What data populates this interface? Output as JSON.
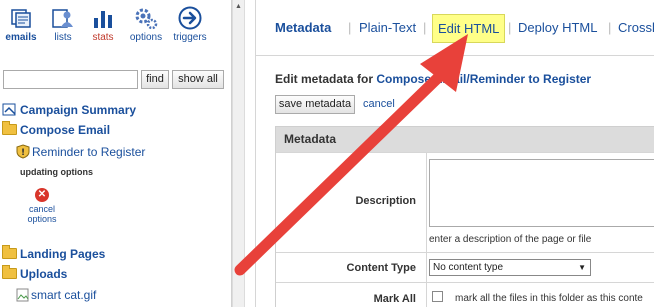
{
  "toolbar": {
    "emails": "emails",
    "lists": "lists",
    "stats": "stats",
    "options": "options",
    "triggers": "triggers"
  },
  "search": {
    "value": "",
    "placeholder": ""
  },
  "buttons": {
    "find": "find",
    "show_all": "show all"
  },
  "tree": {
    "campaign_summary": "Campaign Summary",
    "compose_email": "Compose Email",
    "reminder": "Reminder to Register",
    "updating": "updating options",
    "cancel_options": "cancel options",
    "landing_pages": "Landing Pages",
    "uploads": "Uploads",
    "smart_cat": "smart cat.gif"
  },
  "tabs": {
    "metadata": "Metadata",
    "plain_text": "Plain-Text",
    "edit_html": "Edit HTML",
    "deploy_html": "Deploy HTML",
    "crosslink": "Crosslin",
    "separator": "|"
  },
  "form": {
    "edit_prefix": "Edit metadata for",
    "edit_path": "Compose Email/Reminder to Register",
    "save_button": "save metadata",
    "cancel_link": "cancel",
    "table_header": "Metadata",
    "description_label": "Description",
    "description_value": "",
    "description_hint": "enter a description of the page or file",
    "content_type_label": "Content Type",
    "content_type_value": "No content type",
    "mark_all_label": "Mark All",
    "mark_all_text": "mark all the files in this folder as this conte"
  },
  "colors": {
    "link": "#1a4f9c",
    "highlight": "#ffff88",
    "arrow": "#e8413a"
  }
}
